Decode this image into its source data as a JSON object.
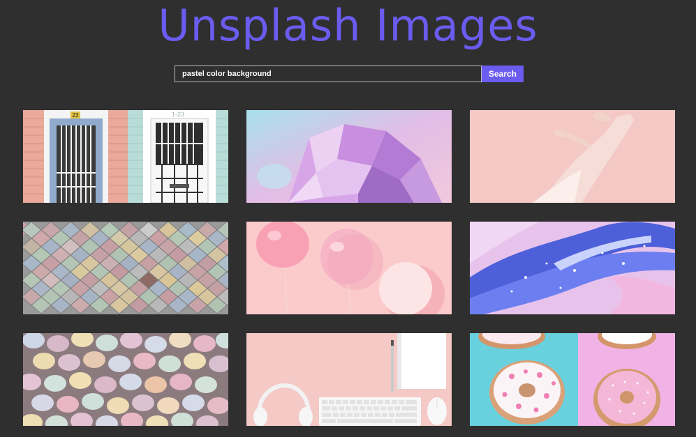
{
  "header": {
    "title": "Unsplash Images"
  },
  "search": {
    "value": "pastel color background",
    "button_label": "Search"
  },
  "colors": {
    "accent": "#6b5cf0",
    "background": "#2f2f2f"
  },
  "gallery": {
    "images": [
      {
        "subject": "doors",
        "door_number": "23",
        "door_number_right": "1-23"
      },
      {
        "subject": "crystal"
      },
      {
        "subject": "hand"
      },
      {
        "subject": "scale-tiles"
      },
      {
        "subject": "balloons"
      },
      {
        "subject": "fluid-art"
      },
      {
        "subject": "easter-eggs"
      },
      {
        "subject": "workspace"
      },
      {
        "subject": "donuts"
      }
    ]
  }
}
